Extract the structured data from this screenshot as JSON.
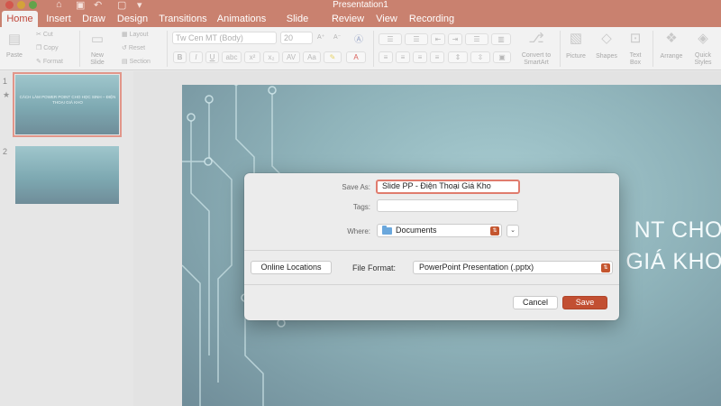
{
  "app": {
    "window_title": "Presentation1"
  },
  "tabs": [
    "Home",
    "Insert",
    "Draw",
    "Design",
    "Transitions",
    "Animations",
    "Slide Show",
    "Review",
    "View",
    "Recording"
  ],
  "ribbon": {
    "paste": "Paste",
    "cut": "Cut",
    "copy": "Copy",
    "format": "Format",
    "new_slide": "New\nSlide",
    "layout": "Layout",
    "reset": "Reset",
    "section": "Section",
    "font_name": "Tw Cen MT (Body)",
    "font_size": "20",
    "convert_smartart": "Convert to\nSmartArt",
    "picture": "Picture",
    "shapes": "Shapes",
    "text_box": "Text\nBox",
    "arrange": "Arrange",
    "quick_styles": "Quick\nStyles"
  },
  "slides": {
    "numbers": [
      "1",
      "2"
    ],
    "thumb1_text": "CÁCH LÀM POWER POINT CHO HỌC SINH – ĐIỆN THOẠI GIÁ KHO"
  },
  "slide_main": {
    "title_line1": "NT CHO",
    "title_line2": "GIÁ KHO"
  },
  "dialog": {
    "save_as_label": "Save As:",
    "save_as_value": "Slide PP - Điện Thoại Giá Kho",
    "tags_label": "Tags:",
    "tags_value": "",
    "where_label": "Where:",
    "where_value": "Documents",
    "online_locations": "Online Locations",
    "file_format_label": "File Format:",
    "file_format_value": "PowerPoint Presentation (.pptx)",
    "cancel": "Cancel",
    "save": "Save"
  },
  "colors": {
    "accent": "#c9816f",
    "save_button": "#c24f32",
    "focus_ring": "#e07c6e"
  }
}
